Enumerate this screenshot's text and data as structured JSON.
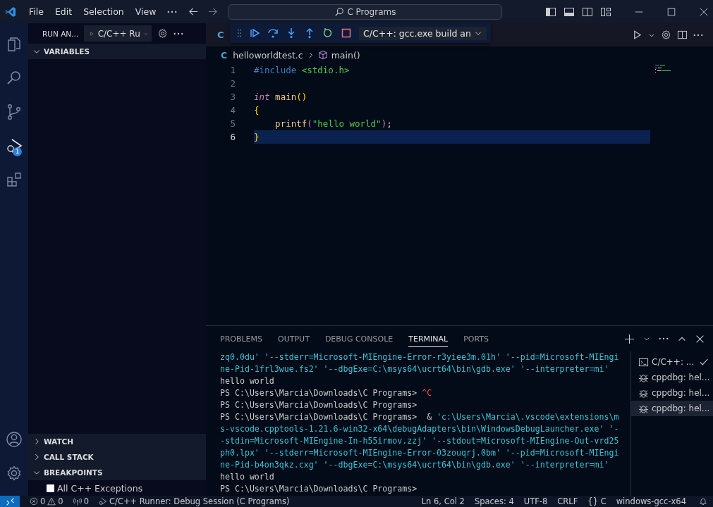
{
  "title_bar": {
    "menus": [
      "File",
      "Edit",
      "Selection",
      "View"
    ],
    "search": {
      "value": "C Programs"
    }
  },
  "activity_bar": {
    "items": [
      {
        "kind": "explorer",
        "selected": false
      },
      {
        "kind": "search",
        "selected": false
      },
      {
        "kind": "source-control",
        "selected": false
      },
      {
        "kind": "run-debug",
        "selected": true,
        "badge": "1"
      },
      {
        "kind": "extensions",
        "selected": false
      }
    ],
    "bottom": [
      {
        "kind": "account"
      },
      {
        "kind": "manage"
      }
    ]
  },
  "sidebar": {
    "title": "RUN AN...",
    "config": "C/C++ Ru",
    "sections": [
      {
        "title": "VARIABLES",
        "expanded": true
      },
      {
        "title": "WATCH",
        "expanded": false
      },
      {
        "title": "CALL STACK",
        "expanded": false
      },
      {
        "title": "BREAKPOINTS",
        "expanded": true,
        "items": [
          {
            "label": "All C++ Exceptions",
            "checked": false
          }
        ]
      }
    ]
  },
  "debug_toolbar": {
    "config": "C/C++: gcc.exe build an"
  },
  "editor": {
    "tab_icon": "C",
    "breadcrumb": {
      "file_icon": "C",
      "file": "helloworldtest.c",
      "symbol": "main()"
    },
    "lines": [
      {
        "number": "1",
        "selected": false,
        "tokens": [
          {
            "kind": "directive",
            "text": "#include"
          },
          {
            "kind": "header",
            "text": " <stdio.h>"
          }
        ]
      },
      {
        "number": "2",
        "selected": false
      },
      {
        "number": "3",
        "selected": false,
        "tokens": [
          {
            "kind": "type",
            "text": "int"
          },
          {
            "kind": "func",
            "text": " main"
          },
          {
            "kind": "bracket",
            "text": "()"
          }
        ]
      },
      {
        "number": "4",
        "selected": false,
        "tokens": [
          {
            "kind": "bracket",
            "text": "{"
          }
        ]
      },
      {
        "number": "5",
        "selected": false,
        "tokens": [
          {
            "kind": "func",
            "text": "    printf"
          },
          {
            "kind": "bracket2",
            "text": "("
          },
          {
            "kind": "string",
            "text": "\"hello world\""
          },
          {
            "kind": "bracket2",
            "text": ")"
          },
          {
            "kind": "plain",
            "text": ";"
          }
        ]
      },
      {
        "number": "6",
        "selected": true,
        "tokens": [
          {
            "kind": "bracket",
            "text": "}"
          }
        ]
      }
    ]
  },
  "panel": {
    "tabs": [
      {
        "label": "PROBLEMS",
        "selected": false
      },
      {
        "label": "OUTPUT",
        "selected": false
      },
      {
        "label": "DEBUG CONSOLE",
        "selected": false
      },
      {
        "label": "TERMINAL",
        "selected": true
      },
      {
        "label": "PORTS",
        "selected": false
      }
    ],
    "terminal_lines": [
      [
        {
          "kind": "string",
          "text": "zq0.0du' '--stderr=Microsoft-MIEngine-Error-r3yiee3m.01h' '--pid=Microsoft-MIEngi"
        }
      ],
      [
        {
          "kind": "string",
          "text": "ne-Pid-1frl3wue.fs2' '--dbgExe=C:\\msys64\\ucrt64\\bin\\gdb.exe' '--interpreter=mi'"
        }
      ],
      [
        {
          "kind": "plain",
          "text": "hello world"
        }
      ],
      [
        {
          "kind": "plain",
          "text": "PS C:\\Users\\Marcia\\Downloads\\C Programs> "
        },
        {
          "kind": "error",
          "text": "^C"
        }
      ],
      [
        {
          "kind": "plain",
          "text": "PS C:\\Users\\Marcia\\Downloads\\C Programs>"
        }
      ],
      [
        {
          "kind": "plain",
          "text": "PS C:\\Users\\Marcia\\Downloads\\C Programs>  & "
        },
        {
          "kind": "string",
          "text": "'c:\\Users\\Marcia\\.vscode\\extensions\\m"
        }
      ],
      [
        {
          "kind": "string",
          "text": "s-vscode.cpptools-1.21.6-win32-x64\\debugAdapters\\bin\\WindowsDebugLauncher.exe' '-"
        }
      ],
      [
        {
          "kind": "string",
          "text": "-stdin=Microsoft-MIEngine-In-h55irmov.zzj' '--stdout=Microsoft-MIEngine-Out-vrd25"
        }
      ],
      [
        {
          "kind": "string",
          "text": "ph0.lpx' '--stderr=Microsoft-MIEngine-Error-03zouqrj.0bm' '--pid=Microsoft-MIEngi"
        }
      ],
      [
        {
          "kind": "string",
          "text": "ne-Pid-b4on3qkz.cxg' '--dbgExe=C:\\msys64\\ucrt64\\bin\\gdb.exe' '--interpreter=mi'"
        }
      ],
      [
        {
          "kind": "plain",
          "text": "hello world"
        }
      ],
      [
        {
          "kind": "plain",
          "text": "PS C:\\Users\\Marcia\\Downloads\\C Programs>"
        }
      ]
    ],
    "terminals": [
      {
        "kind": "task",
        "label": "C/C++: ...",
        "selected": false,
        "completed": true
      },
      {
        "kind": "debug",
        "label": "cppdbg: hel...",
        "selected": false,
        "completed": false
      },
      {
        "kind": "debug",
        "label": "cppdbg: hel...",
        "selected": false,
        "completed": false
      },
      {
        "kind": "debug",
        "label": "cppdbg: hel...",
        "selected": true,
        "completed": false
      }
    ]
  },
  "status_bar": {
    "errors": "0",
    "warnings": "0",
    "ports": "0",
    "debug_session": "C/C++ Runner: Debug Session (C Programs)",
    "items": [
      "Ln 6, Col 2",
      "Spaces: 4",
      "UTF-8",
      "CRLF",
      "{} C",
      "windows-gcc-x64"
    ]
  }
}
